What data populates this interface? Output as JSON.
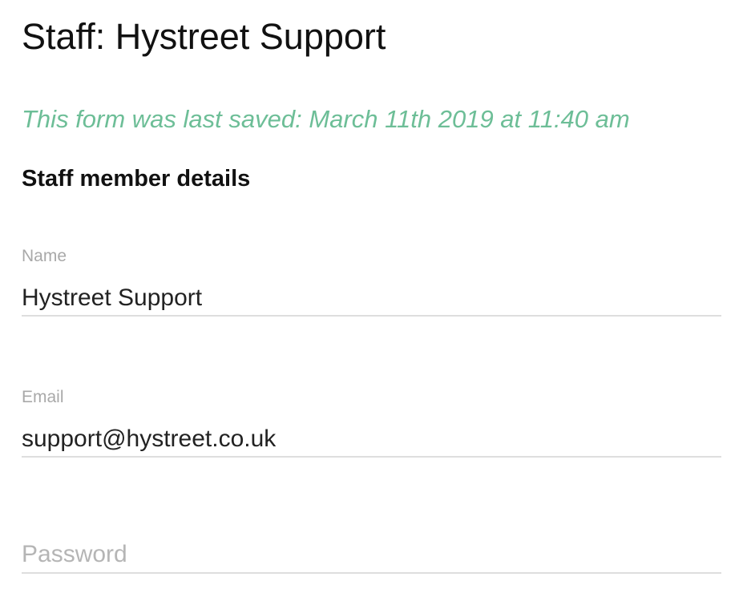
{
  "page": {
    "title": "Staff: Hystreet Support",
    "saved_note": "This form was last saved: March 11th 2019 at 11:40 am",
    "saved_note_color": "#6dbe97"
  },
  "section": {
    "heading": "Staff member details"
  },
  "form": {
    "name": {
      "label": "Name",
      "value": "Hystreet Support"
    },
    "email": {
      "label": "Email",
      "value": "support@hystreet.co.uk"
    },
    "password": {
      "placeholder": "Password",
      "value": ""
    }
  }
}
